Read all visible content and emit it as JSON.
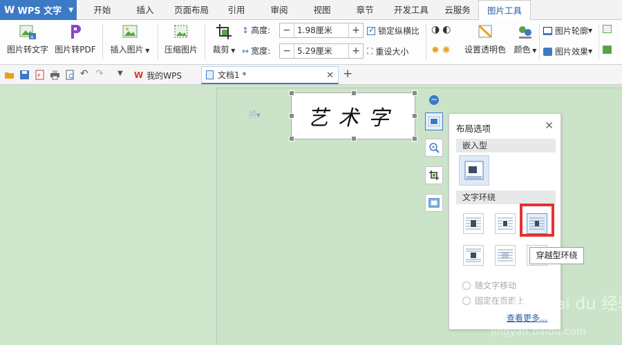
{
  "app": {
    "name": "WPS 文字"
  },
  "menu": {
    "items": [
      {
        "label": "开始"
      },
      {
        "label": "插入"
      },
      {
        "label": "页面布局"
      },
      {
        "label": "引用"
      },
      {
        "label": "审阅"
      },
      {
        "label": "视图"
      },
      {
        "label": "章节"
      },
      {
        "label": "开发工具"
      },
      {
        "label": "云服务"
      },
      {
        "label": "图片工具"
      }
    ],
    "active": "图片工具"
  },
  "ribbon": {
    "img_to_text": "图片转文字",
    "img_to_pdf": "图片转PDF",
    "insert_image": "插入图片",
    "compress_image": "压缩图片",
    "crop": "裁剪",
    "height_label": "高度:",
    "height_value": "1.98厘米",
    "width_label": "宽度:",
    "width_value": "5.29厘米",
    "lock_ratio": "锁定纵横比",
    "reset_size": "重设大小",
    "set_transparent": "设置透明色",
    "color": "颜色",
    "image_outline": "图片轮廓",
    "image_effect": "图片效果"
  },
  "tabs": {
    "my_wps": "我的WPS",
    "doc1": "文档1 *"
  },
  "image": {
    "text": "艺术字"
  },
  "layout_panel": {
    "title": "布局选项",
    "inline_header": "嵌入型",
    "wrap_header": "文字环绕",
    "move_with_text": "随文字移动",
    "fix_on_page": "固定在页面上",
    "see_more": "查看更多..."
  },
  "tooltip": {
    "text": "穿越型环绕"
  },
  "colors": {
    "accent": "#3c7ac6",
    "highlight": "#e53030",
    "canvas": "#cfe5cc"
  }
}
